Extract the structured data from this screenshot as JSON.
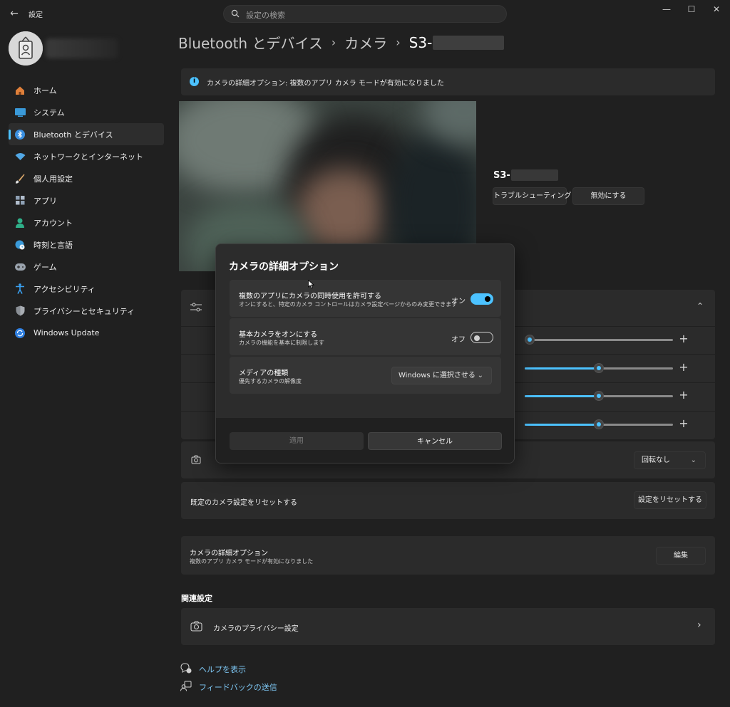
{
  "titlebar": {
    "app_title": "設定",
    "search_placeholder": "設定の検索",
    "minimize": "—",
    "maximize": "☐",
    "close": "✕"
  },
  "sidebar": {
    "items": [
      {
        "label": "ホーム",
        "icon": "home-icon",
        "color": "#e0803a"
      },
      {
        "label": "システム",
        "icon": "system-icon",
        "color": "#3a9ad9"
      },
      {
        "label": "Bluetooth とデバイス",
        "icon": "bluetooth-icon",
        "color": "#3a8fe0",
        "active": true
      },
      {
        "label": "ネットワークとインターネット",
        "icon": "network-icon",
        "color": "#52a8e6"
      },
      {
        "label": "個人用設定",
        "icon": "brush-icon",
        "color": "#d9a66a"
      },
      {
        "label": "アプリ",
        "icon": "apps-icon",
        "color": "#8ea0b4"
      },
      {
        "label": "アカウント",
        "icon": "account-icon",
        "color": "#2fb08a"
      },
      {
        "label": "時刻と言語",
        "icon": "globe-clock-icon",
        "color": "#3a9ad9"
      },
      {
        "label": "ゲーム",
        "icon": "gamepad-icon",
        "color": "#9aa3ad"
      },
      {
        "label": "アクセシビリティ",
        "icon": "accessibility-icon",
        "color": "#3aa0f0"
      },
      {
        "label": "プライバシーとセキュリティ",
        "icon": "shield-icon",
        "color": "#8a8f96"
      },
      {
        "label": "Windows Update",
        "icon": "update-icon",
        "color": "#2f7fe0"
      }
    ]
  },
  "header": {
    "crumb1": "Bluetooth とデバイス",
    "crumb2": "カメラ",
    "crumb3": "S3-"
  },
  "info_bar": {
    "text": "カメラの詳細オプション: 複数のアプリ カメラ モードが有効になりました"
  },
  "device": {
    "name": "S3-",
    "troubleshoot": "トラブルシューティング",
    "disable": "無効にする"
  },
  "sliders": [
    {
      "fraction": 0.0
    },
    {
      "fraction": 0.5
    },
    {
      "fraction": 0.5
    },
    {
      "fraction": 0.5
    }
  ],
  "rotation": {
    "value": "回転なし"
  },
  "reset": {
    "label": "既定のカメラ設定をリセットする",
    "button": "設定をリセットする"
  },
  "advanced": {
    "title": "カメラの詳細オプション",
    "subtitle": "複数のアプリ カメラ モードが有効になりました",
    "button": "編集"
  },
  "related": {
    "heading": "関連設定",
    "privacy": "カメラのプライバシー設定"
  },
  "links": {
    "help": "ヘルプを表示",
    "feedback": "フィードバックの送信"
  },
  "dialog": {
    "title": "カメラの詳細オプション",
    "options": [
      {
        "title": "複数のアプリにカメラの同時使用を許可する",
        "subtitle": "オンにすると、特定のカメラ コントロールはカメラ設定ページからのみ変更できます",
        "state_label": "オン",
        "on": true
      },
      {
        "title": "基本カメラをオンにする",
        "subtitle": "カメラの機能を基本に制限します",
        "state_label": "オフ",
        "on": false
      },
      {
        "title": "メディアの種類",
        "subtitle": "優先するカメラの解像度",
        "select_value": "Windows に選択させる"
      }
    ],
    "apply": "適用",
    "cancel": "キャンセル"
  },
  "colors": {
    "accent": "#4cc2ff",
    "background": "#202020",
    "card": "#2b2b2b"
  }
}
